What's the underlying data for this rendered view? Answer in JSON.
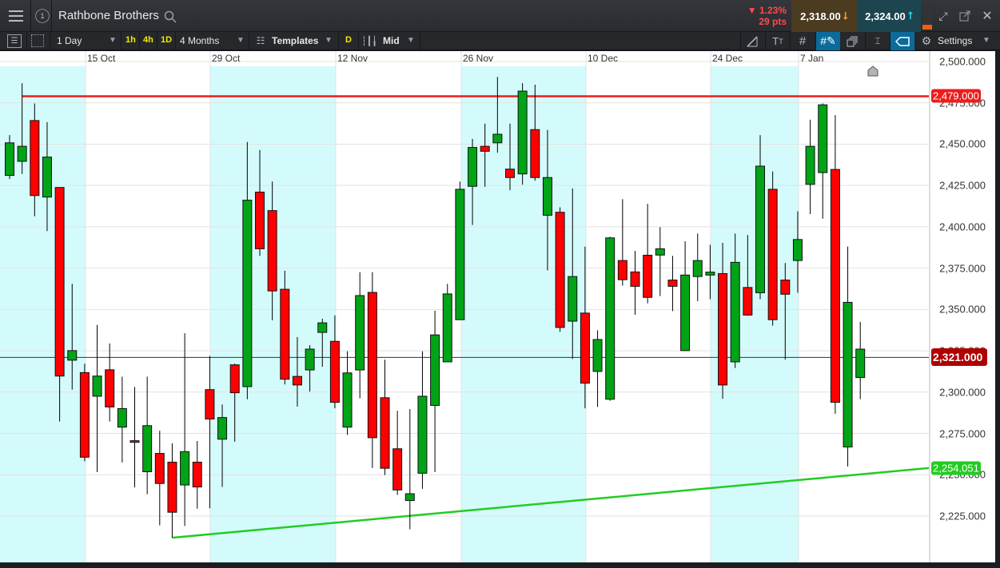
{
  "header": {
    "instrument": "Rathbone Brothers",
    "window_number": "1",
    "change_pct": "1.23%",
    "change_pts": "29 pts",
    "sell_price": "2,318.00",
    "buy_price": "2,324.00"
  },
  "toolbar": {
    "interval": "1 Day",
    "quick_1h": "1h",
    "quick_4h": "4h",
    "quick_1d": "1D",
    "range": "4 Months",
    "templates": "Templates",
    "d_label": "D",
    "price_type": "Mid",
    "settings": "Settings"
  },
  "colors": {
    "up": "#00a416",
    "down": "#ff0000",
    "band": "#d4fbfc",
    "resistance": "#ee1c1c",
    "support": "#22cc22",
    "current": "#b00000"
  },
  "chart_data": {
    "type": "candlestick",
    "x_labels": [
      "15 Oct",
      "29 Oct",
      "12 Nov",
      "26 Nov",
      "10 Dec",
      "24 Dec",
      "7 Jan"
    ],
    "y_ticks": [
      "2,500.000",
      "2,475.000",
      "2,450.000",
      "2,425.000",
      "2,400.000",
      "2,375.000",
      "2,350.000",
      "2,325.000",
      "2,300.000",
      "2,275.000",
      "2,250.000",
      "2,225.000"
    ],
    "y_tick_values": [
      2500,
      2475,
      2450,
      2425,
      2400,
      2375,
      2350,
      2325,
      2300,
      2275,
      2250,
      2225
    ],
    "ylim": [
      2196,
      2506
    ],
    "resistance": {
      "value": 2479,
      "label": "2,479.000"
    },
    "current": {
      "value": 2321,
      "label": "2,321.000"
    },
    "support": {
      "start": 2211.9,
      "end": 2254.051,
      "label": "2,254.051"
    },
    "ohlc": [
      [
        2431.1,
        2455.5,
        2428.9,
        2450.8
      ],
      [
        2439.6,
        2486.9,
        2432.0,
        2448.7
      ],
      [
        2464.3,
        2474.6,
        2406.4,
        2418.9
      ],
      [
        2418.0,
        2463.3,
        2397.4,
        2442.2
      ],
      [
        2423.8,
        2423.8,
        2282.2,
        2309.7
      ],
      [
        2319.3,
        2365.5,
        2301.5,
        2325.1
      ],
      [
        2311.8,
        2317.2,
        2258.2,
        2260.6
      ],
      [
        2297.5,
        2340.6,
        2251.6,
        2309.7
      ],
      [
        2313.5,
        2329.4,
        2282.2,
        2291.0
      ],
      [
        2278.8,
        2309.3,
        2257.4,
        2290.0
      ],
      [
        2270.6,
        2303.1,
        2242.3,
        2269.6
      ],
      [
        2251.8,
        2309.3,
        2238.2,
        2279.7
      ],
      [
        2262.9,
        2276.6,
        2219.4,
        2244.7
      ],
      [
        2257.6,
        2269.0,
        2211.9,
        2227.3
      ],
      [
        2243.8,
        2335.6,
        2219.0,
        2264.0
      ],
      [
        2257.6,
        2270.4,
        2229.5,
        2242.6
      ],
      [
        2301.5,
        2321.9,
        2229.7,
        2283.7
      ],
      [
        2271.5,
        2292.5,
        2242.6,
        2284.6
      ],
      [
        2316.5,
        2317.2,
        2270.0,
        2299.6
      ],
      [
        2303.3,
        2451.3,
        2295.7,
        2416.1
      ],
      [
        2421.0,
        2446.5,
        2382.4,
        2386.7
      ],
      [
        2409.8,
        2427.4,
        2343.4,
        2361.2
      ],
      [
        2362.2,
        2373.4,
        2304.6,
        2307.8
      ],
      [
        2309.5,
        2333.3,
        2291.2,
        2304.3
      ],
      [
        2313.4,
        2328.4,
        2300.3,
        2326.0
      ],
      [
        2336.1,
        2344.4,
        2315.3,
        2341.9
      ],
      [
        2330.7,
        2346.4,
        2290.2,
        2293.8
      ],
      [
        2278.8,
        2324.7,
        2274.1,
        2311.6
      ],
      [
        2313.4,
        2372.5,
        2296.2,
        2358.4
      ],
      [
        2360.3,
        2372.5,
        2254.1,
        2272.4
      ],
      [
        2296.6,
        2319.6,
        2249.8,
        2253.9
      ],
      [
        2265.7,
        2288.7,
        2237.8,
        2240.8
      ],
      [
        2234.4,
        2289.7,
        2217.0,
        2238.5
      ],
      [
        2250.9,
        2324.7,
        2241.5,
        2297.5
      ],
      [
        2291.9,
        2349.2,
        2251.6,
        2334.6
      ],
      [
        2318.3,
        2365.5,
        2318.3,
        2359.4
      ],
      [
        2343.8,
        2427.4,
        2343.8,
        2422.7
      ],
      [
        2424.5,
        2453.2,
        2401.1,
        2448.0
      ],
      [
        2448.7,
        2462.4,
        2424.2,
        2445.7
      ],
      [
        2450.8,
        2490.7,
        2444.8,
        2456.0
      ],
      [
        2434.9,
        2462.4,
        2422.1,
        2429.8
      ],
      [
        2432.0,
        2486.9,
        2425.5,
        2482.1
      ],
      [
        2458.8,
        2486.0,
        2427.9,
        2429.8
      ],
      [
        2407.0,
        2458.6,
        2373.6,
        2429.8
      ],
      [
        2408.8,
        2411.8,
        2336.5,
        2339.1
      ],
      [
        2342.9,
        2423.2,
        2320.0,
        2369.9
      ],
      [
        2347.8,
        2388.0,
        2290.2,
        2305.4
      ],
      [
        2312.5,
        2337.4,
        2291.0,
        2331.8
      ],
      [
        2295.7,
        2394.0,
        2294.7,
        2393.3
      ],
      [
        2379.6,
        2416.7,
        2364.4,
        2368.0
      ],
      [
        2372.7,
        2385.4,
        2346.8,
        2364.0
      ],
      [
        2382.8,
        2413.9,
        2353.7,
        2357.3
      ],
      [
        2382.9,
        2399.8,
        2358.1,
        2386.7
      ],
      [
        2367.8,
        2382.4,
        2349.0,
        2364.0
      ],
      [
        2325.1,
        2391.2,
        2325.1,
        2370.8
      ],
      [
        2369.9,
        2395.9,
        2355.0,
        2379.6
      ],
      [
        2370.8,
        2389.1,
        2356.2,
        2372.6
      ],
      [
        2371.7,
        2390.3,
        2296.0,
        2304.3
      ],
      [
        2318.3,
        2395.9,
        2314.6,
        2378.5
      ],
      [
        2363.3,
        2395.0,
        2346.2,
        2346.6
      ],
      [
        2360.1,
        2455.5,
        2356.2,
        2436.7
      ],
      [
        2422.7,
        2433.5,
        2340.2,
        2343.8
      ],
      [
        2367.8,
        2378.1,
        2319.6,
        2359.2
      ],
      [
        2379.6,
        2409.4,
        2360.1,
        2392.3
      ],
      [
        2425.7,
        2464.8,
        2407.7,
        2448.7
      ],
      [
        2432.8,
        2474.6,
        2404.9,
        2473.8
      ],
      [
        2434.7,
        2467.6,
        2286.9,
        2293.8
      ],
      [
        2266.8,
        2388.0,
        2255.0,
        2354.3
      ],
      [
        2308.8,
        2342.5,
        2295.7,
        2326.0
      ]
    ]
  }
}
